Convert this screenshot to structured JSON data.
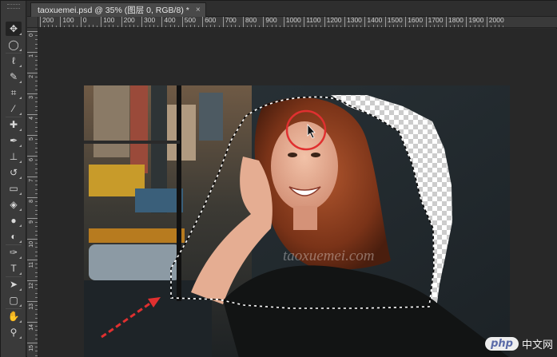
{
  "document": {
    "tab_title": "taoxuemei.psd @ 35% (图层 0, RGB/8) *",
    "close_symbol": "×"
  },
  "ruler": {
    "top_labels": [
      "200",
      "100",
      "0",
      "100",
      "200",
      "300",
      "400",
      "500",
      "600",
      "700",
      "800",
      "900",
      "1000",
      "1100",
      "1200",
      "1300",
      "1400",
      "1500",
      "1600",
      "1700",
      "1800",
      "1900",
      "2000"
    ],
    "left_labels": [
      "0",
      "1",
      "2",
      "3",
      "4",
      "5",
      "6",
      "7",
      "8",
      "9",
      "10",
      "11",
      "12",
      "13",
      "14",
      "15"
    ]
  },
  "tools": [
    {
      "name": "move-tool",
      "icon": "move-icon",
      "glyph": "✥",
      "active": true
    },
    {
      "name": "marquee-tool",
      "icon": "elliptical-marquee-icon",
      "glyph": "◯"
    },
    {
      "name": "lasso-tool",
      "icon": "lasso-icon",
      "glyph": "ℓ"
    },
    {
      "name": "quick-selection-tool",
      "icon": "quick-selection-icon",
      "glyph": "✎"
    },
    {
      "name": "crop-tool",
      "icon": "crop-icon",
      "glyph": "⌗"
    },
    {
      "name": "eyedropper-tool",
      "icon": "eyedropper-icon",
      "glyph": "⁄"
    },
    {
      "name": "healing-brush-tool",
      "icon": "healing-brush-icon",
      "glyph": "✚"
    },
    {
      "name": "brush-tool",
      "icon": "brush-icon",
      "glyph": "✒"
    },
    {
      "name": "clone-stamp-tool",
      "icon": "stamp-icon",
      "glyph": "⊥"
    },
    {
      "name": "history-brush-tool",
      "icon": "history-brush-icon",
      "glyph": "↺"
    },
    {
      "name": "eraser-tool",
      "icon": "eraser-icon",
      "glyph": "▭"
    },
    {
      "name": "paint-bucket-tool",
      "icon": "paint-bucket-icon",
      "glyph": "◈"
    },
    {
      "name": "blur-tool",
      "icon": "blur-drop-icon",
      "glyph": "●"
    },
    {
      "name": "dodge-tool",
      "icon": "dodge-icon",
      "glyph": "◐"
    },
    {
      "name": "pen-tool",
      "icon": "pen-icon",
      "glyph": "✑"
    },
    {
      "name": "type-tool",
      "icon": "type-icon",
      "glyph": "T"
    },
    {
      "name": "path-selection-tool",
      "icon": "path-selection-icon",
      "glyph": "➤"
    },
    {
      "name": "rectangle-tool",
      "icon": "rectangle-icon",
      "glyph": "▢"
    },
    {
      "name": "hand-tool",
      "icon": "hand-icon",
      "glyph": "✋"
    },
    {
      "name": "zoom-tool",
      "icon": "zoom-icon",
      "glyph": "⚲"
    }
  ],
  "canvas": {
    "watermark_text": "taoxuemei.com",
    "highlight_color": "#e03030",
    "arrow_color": "#e03030"
  },
  "site_watermark": {
    "badge": "php",
    "text": "中文网"
  }
}
